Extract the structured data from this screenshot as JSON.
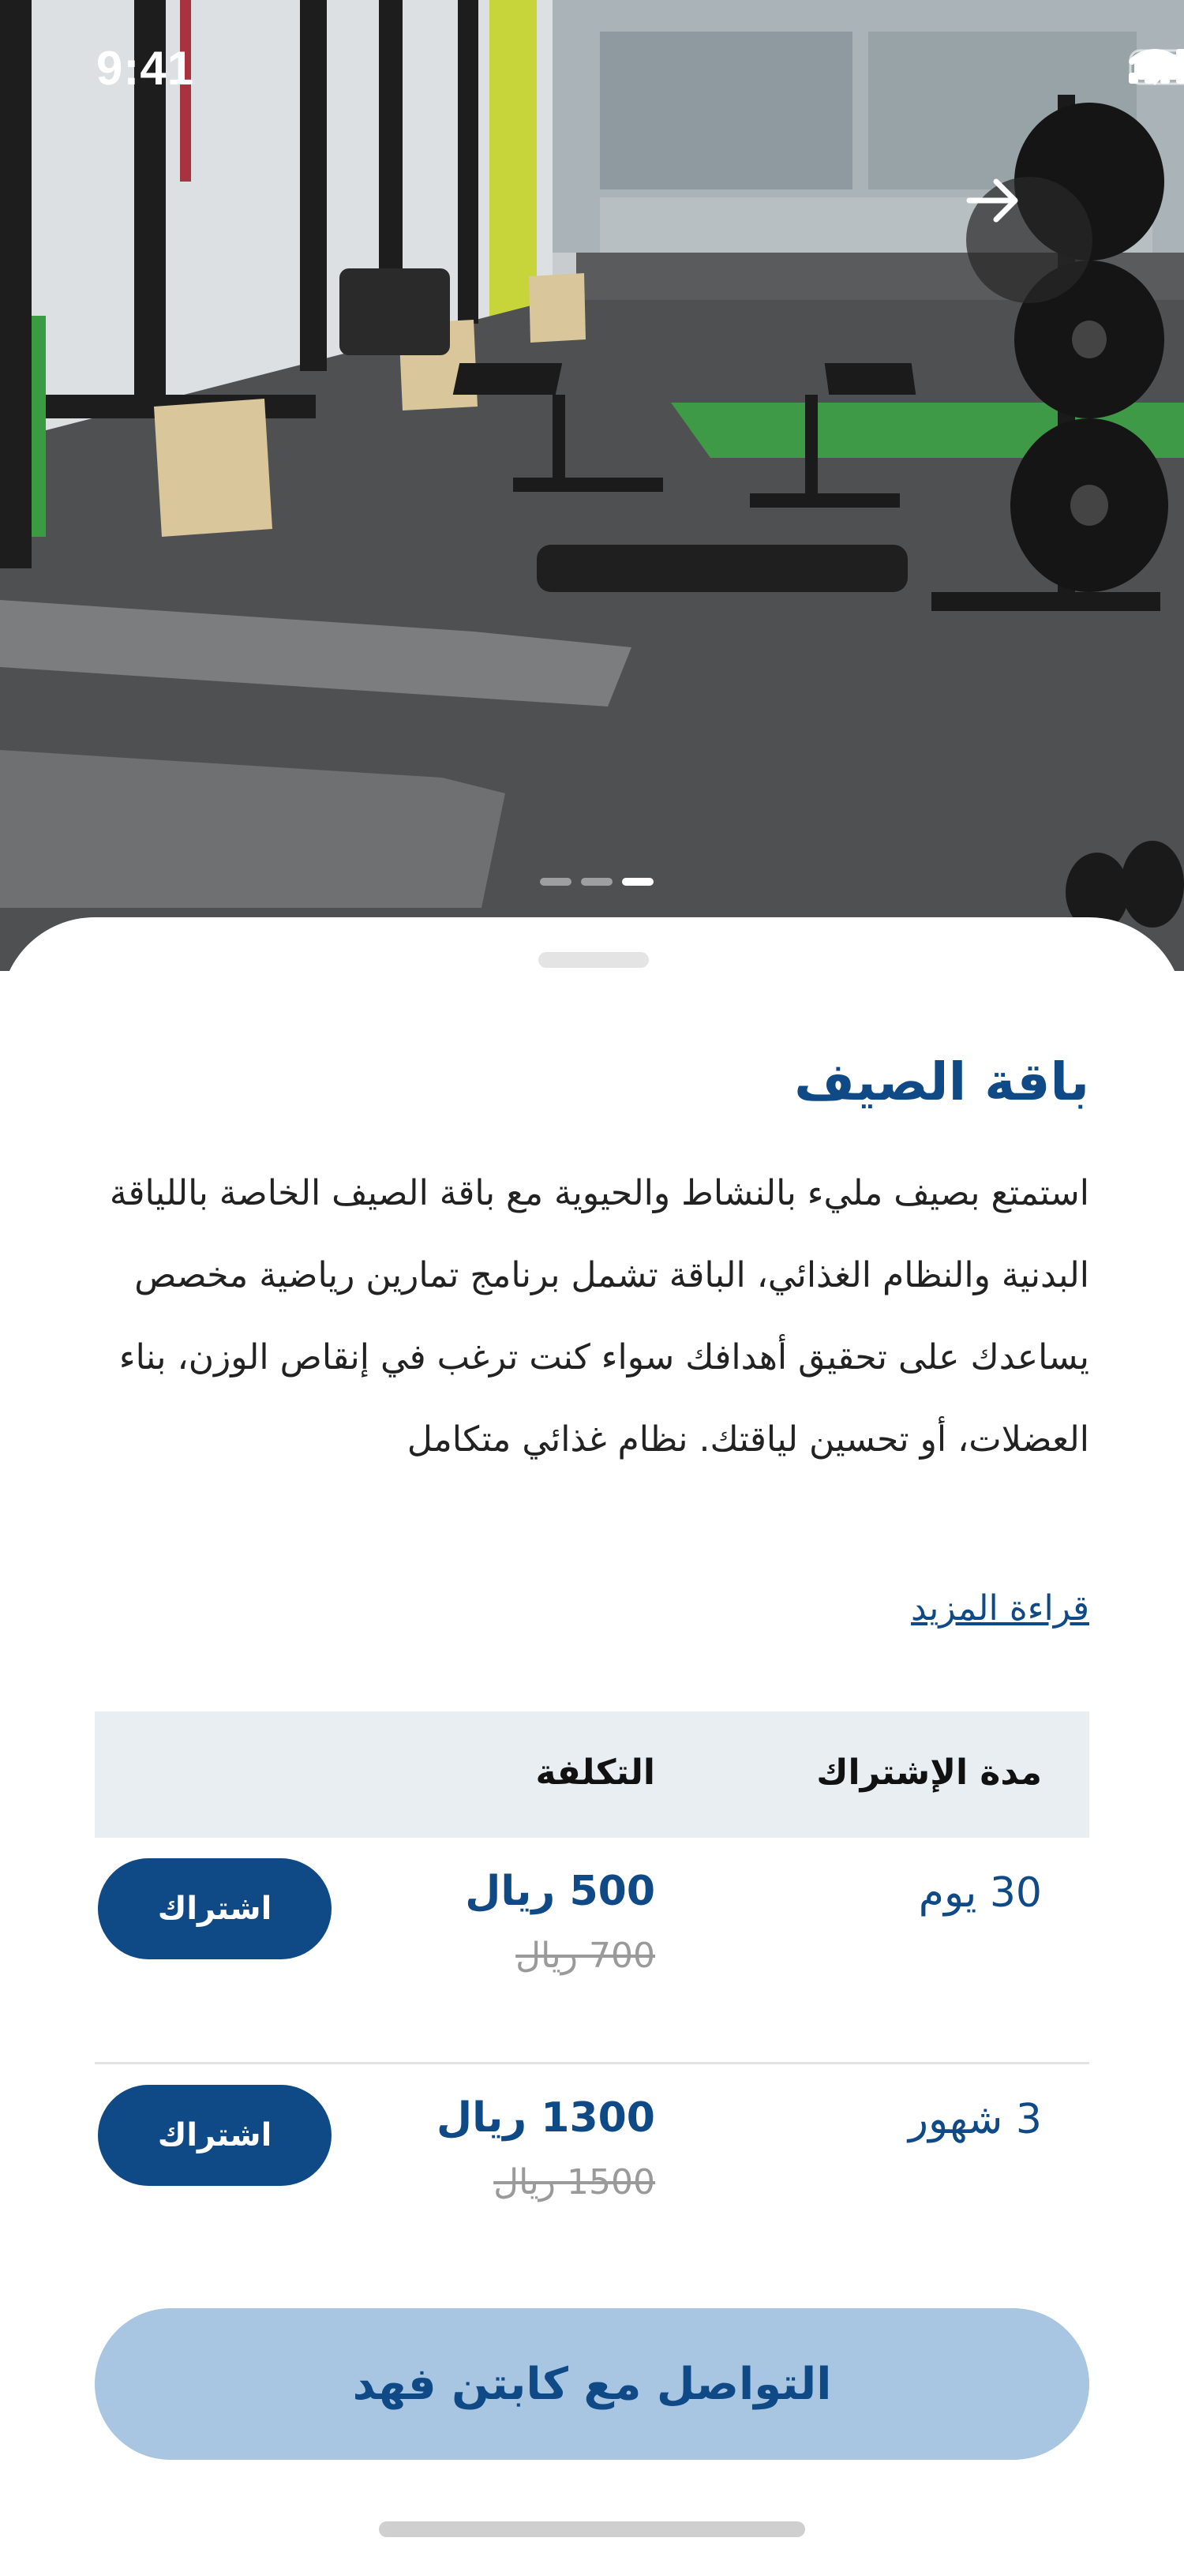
{
  "status_bar": {
    "time": "9:41",
    "icons": [
      "cellular-signal-icon",
      "wifi-icon",
      "battery-icon"
    ]
  },
  "gallery": {
    "next_icon": "arrow-right-icon",
    "page_count": 3,
    "active_page": 3
  },
  "package": {
    "title": "باقة الصيف",
    "description": "استمتع بصيف مليء بالنشاط والحيوية مع باقة الصيف الخاصة باللياقة البدنية والنظام الغذائي، الباقة تشمل برنامج تمارين رياضية مخصص يساعدك على تحقيق أهدافك سواء كنت ترغب في إنقاص الوزن، بناء العضلات، أو تحسين لياقتك. نظام غذائي متكامل",
    "read_more": "قراءة المزيد"
  },
  "table": {
    "header_duration": "مدة الإشتراك",
    "header_cost": "التكلفة",
    "rows": [
      {
        "duration": "30 يوم",
        "price": "500 ريال",
        "old_price": "700 ريال",
        "button": "اشتراك"
      },
      {
        "duration": "3 شهور",
        "price": "1300 ريال",
        "old_price": "1500 ريال",
        "button": "اشتراك"
      }
    ]
  },
  "contact_button": "التواصل مع كابتن فهد",
  "colors": {
    "primary": "#0f4a87",
    "contact_bg": "#a8c6e1",
    "table_header_bg": "#e9eef3"
  }
}
